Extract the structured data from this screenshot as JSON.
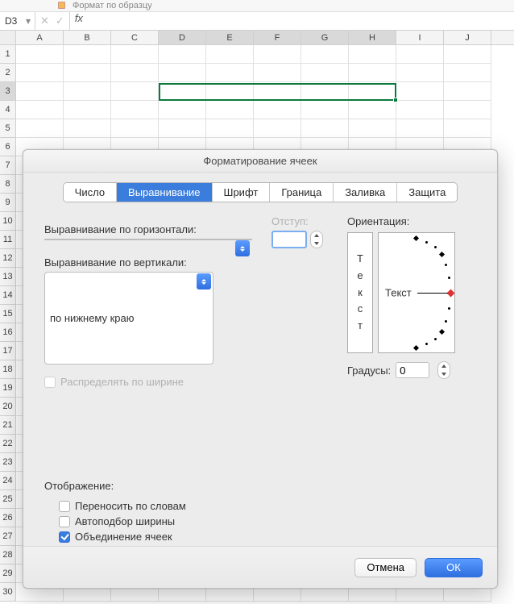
{
  "ribbon": {
    "format_painter": "Формат по образцу"
  },
  "namebox": {
    "ref": "D3"
  },
  "formula_bar": {
    "cancel": "✕",
    "confirm": "✓",
    "fx": "fx",
    "value": ""
  },
  "columns": [
    "A",
    "B",
    "C",
    "D",
    "E",
    "F",
    "G",
    "H",
    "I",
    "J"
  ],
  "rows": [
    1,
    2,
    3,
    4,
    5,
    6,
    7,
    8,
    9,
    10,
    11,
    12,
    13,
    14,
    15,
    16,
    17,
    18,
    19,
    20,
    21,
    22,
    23,
    24,
    25,
    26,
    27,
    28,
    29,
    30
  ],
  "dialog": {
    "title": "Форматирование ячеек",
    "tabs": [
      "Число",
      "Выравнивание",
      "Шрифт",
      "Граница",
      "Заливка",
      "Защита"
    ],
    "active_tab": 1,
    "labels": {
      "h_align": "Выравнивание по горизонтали:",
      "v_align": "Выравнивание по вертикали:",
      "indent": "Отступ:",
      "distribute": "Распределять по ширине",
      "display": "Отображение:",
      "wrap": "Переносить по словам",
      "shrink": "Автоподбор ширины",
      "merge": "Объединение ячеек",
      "orientation": "Ориентация:",
      "degrees": "Градусы:"
    },
    "values": {
      "h_align": "",
      "v_align": "по нижнему краю",
      "indent": "",
      "distribute_checked": false,
      "wrap_checked": false,
      "shrink_checked": false,
      "merge_checked": true,
      "degrees": 0,
      "orient_text_v": [
        "Т",
        "е",
        "к",
        "с",
        "т"
      ],
      "orient_text_h": "Текст"
    },
    "buttons": {
      "cancel": "Отмена",
      "ok": "ОК"
    }
  }
}
